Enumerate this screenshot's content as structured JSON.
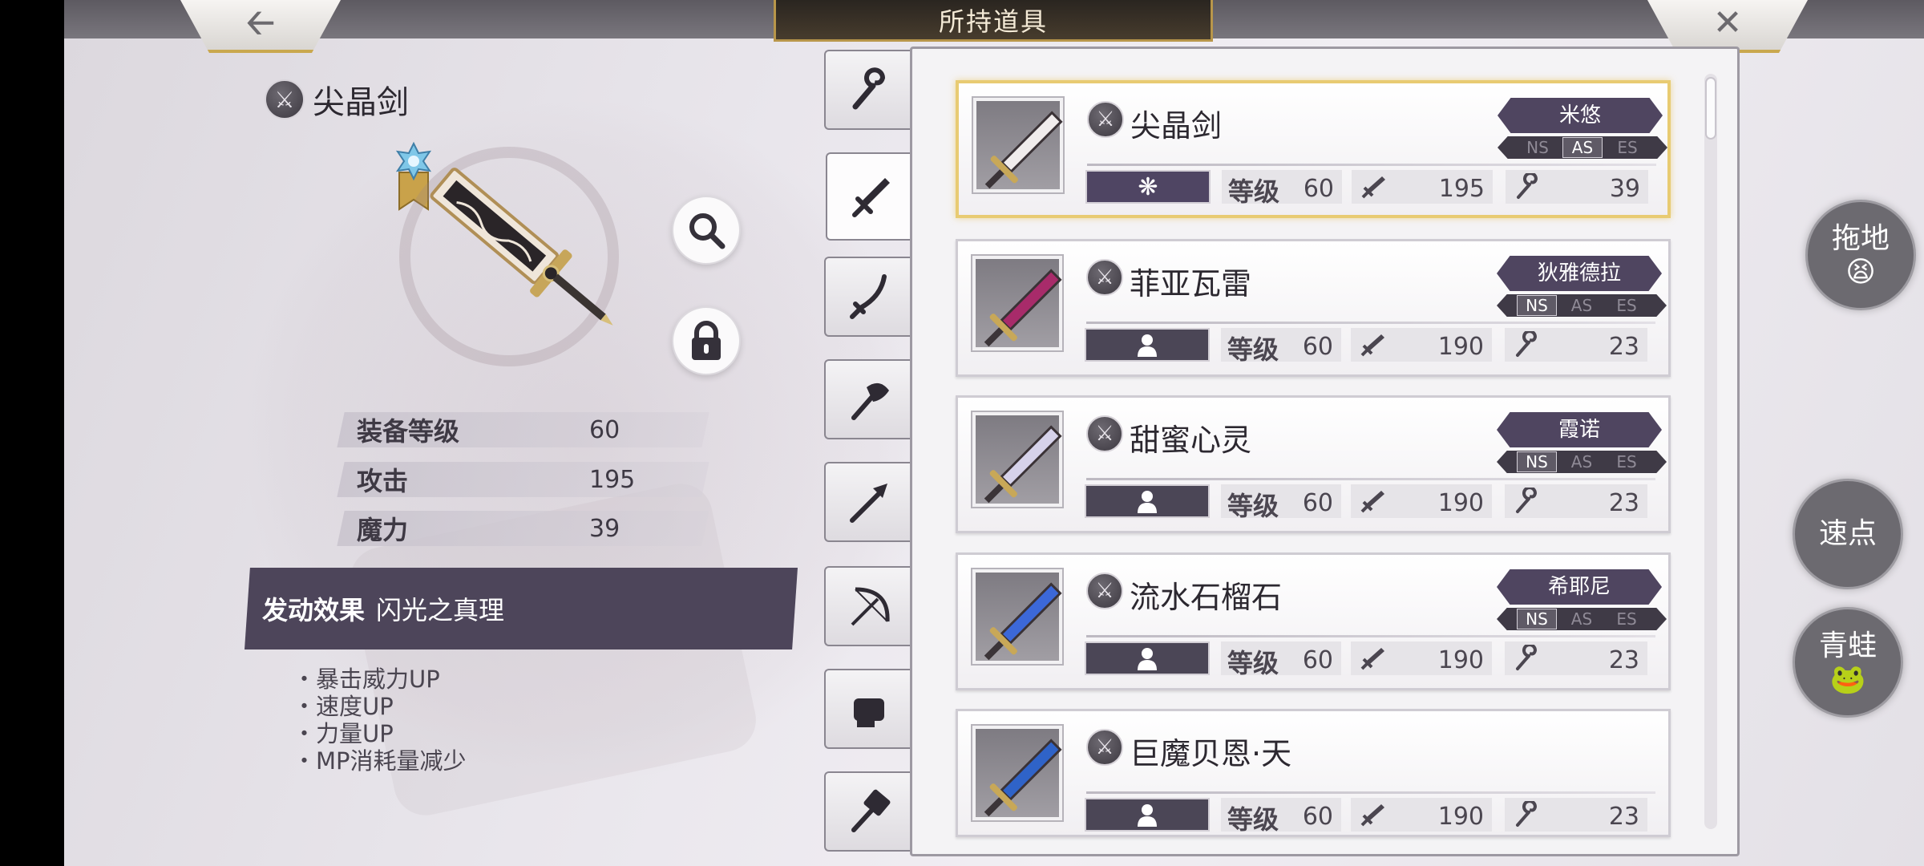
{
  "header": {
    "title": "所持道具",
    "back_icon": "arrow-left-icon",
    "close_icon": "close-x-icon"
  },
  "detail": {
    "name": "尖晶剑",
    "stats": [
      {
        "label": "装备等级",
        "value": "60"
      },
      {
        "label": "攻击",
        "value": "195"
      },
      {
        "label": "魔力",
        "value": "39"
      }
    ],
    "effect_label": "发动效果",
    "effect_name": "闪光之真理",
    "effects": [
      "暴击威力UP",
      "速度UP",
      "力量UP",
      "MP消耗量减少"
    ]
  },
  "tabs": [
    "staff",
    "sword",
    "katana",
    "axe",
    "spear",
    "bow",
    "fist",
    "hammer"
  ],
  "level_label": "等级",
  "weapons": [
    {
      "name": "尖晶剑",
      "character": "米悠",
      "ns": [
        "NS",
        "AS",
        "ES"
      ],
      "active": "AS",
      "level": "60",
      "attack": "195",
      "magic": "39",
      "selected": true,
      "blade": "#f0ecec"
    },
    {
      "name": "菲亚瓦雷",
      "character": "狄雅德拉",
      "ns": [
        "NS",
        "AS",
        "ES"
      ],
      "active": "NS",
      "level": "60",
      "attack": "190",
      "magic": "23",
      "selected": false,
      "blade": "#a82b6a"
    },
    {
      "name": "甜蜜心灵",
      "character": "霞诺",
      "ns": [
        "NS",
        "AS",
        "ES"
      ],
      "active": "NS",
      "level": "60",
      "attack": "190",
      "magic": "23",
      "selected": false,
      "blade": "#d6d2ea"
    },
    {
      "name": "流水石榴石",
      "character": "希耶尼",
      "ns": [
        "NS",
        "AS",
        "ES"
      ],
      "active": "NS",
      "level": "60",
      "attack": "190",
      "magic": "23",
      "selected": false,
      "blade": "#3c68d8"
    },
    {
      "name": "巨魔贝恩·天",
      "character": "",
      "ns": [],
      "active": "",
      "level": "60",
      "attack": "190",
      "magic": "23",
      "selected": false,
      "blade": "#2f63c8"
    }
  ],
  "bubbles": [
    {
      "text": "拖地",
      "emoji": "😫"
    },
    {
      "text": "速点",
      "emoji": ""
    },
    {
      "text": "青蛙",
      "emoji": "🐸"
    }
  ],
  "colors": {
    "accent_gold": "#e8cb72",
    "plate_purple": "#4f4560",
    "effect_bar": "#4d455a"
  }
}
